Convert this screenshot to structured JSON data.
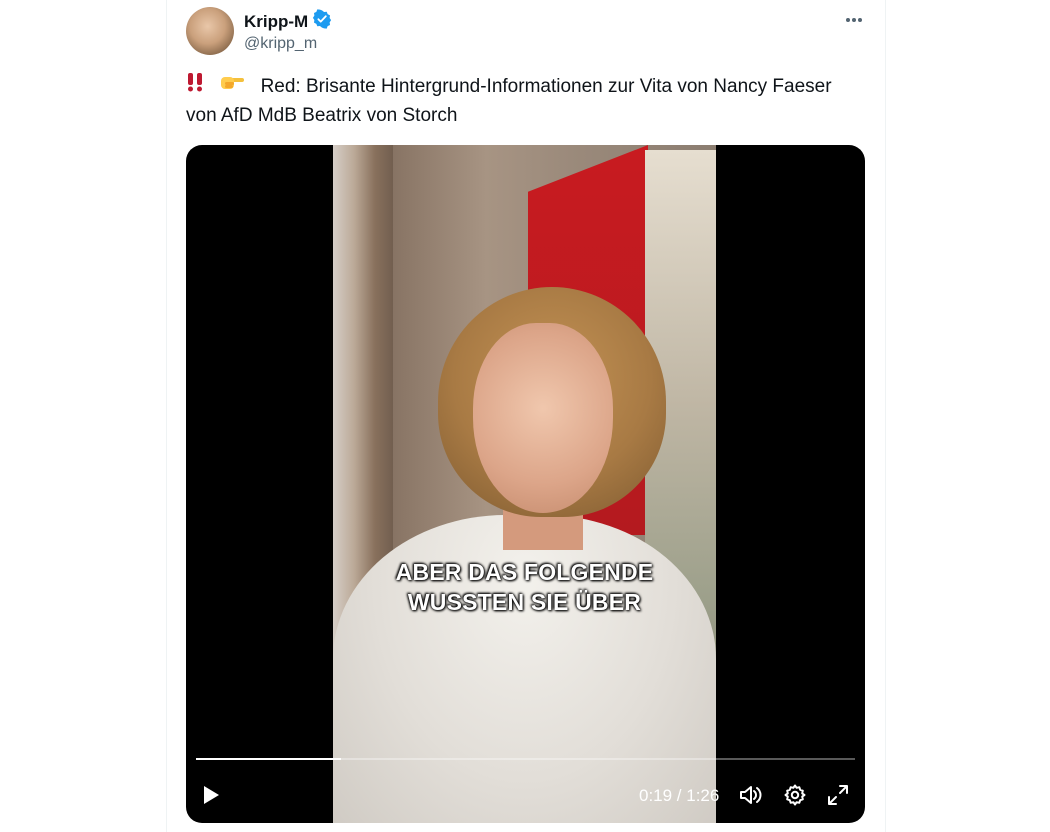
{
  "author": {
    "display_name": "Kripp-M",
    "handle": "@kripp_m",
    "verified": true,
    "avatar_icon": "user-avatar"
  },
  "tweet": {
    "emojis": [
      "double-exclamation-mark",
      "backhand-index-pointing-right"
    ],
    "text": "Red: Brisante Hintergrund-Informationen zur Vita von Nancy Faeser von AfD MdB Beatrix von Storch"
  },
  "video": {
    "subtitle_line1": "ABER DAS FOLGENDE",
    "subtitle_line2": "WUSSTEN SIE ÜBER",
    "current_time": "0:19",
    "duration": "1:26",
    "time_display": "0:19 / 1:26",
    "progress_fraction": 0.22
  },
  "colors": {
    "verified_blue": "#1d9bf0",
    "text_primary": "#0f1419",
    "text_secondary": "#536471"
  },
  "icons": [
    "verified-badge-icon",
    "more-options-icon",
    "play-icon",
    "volume-icon",
    "settings-gear-icon",
    "fullscreen-icon"
  ]
}
